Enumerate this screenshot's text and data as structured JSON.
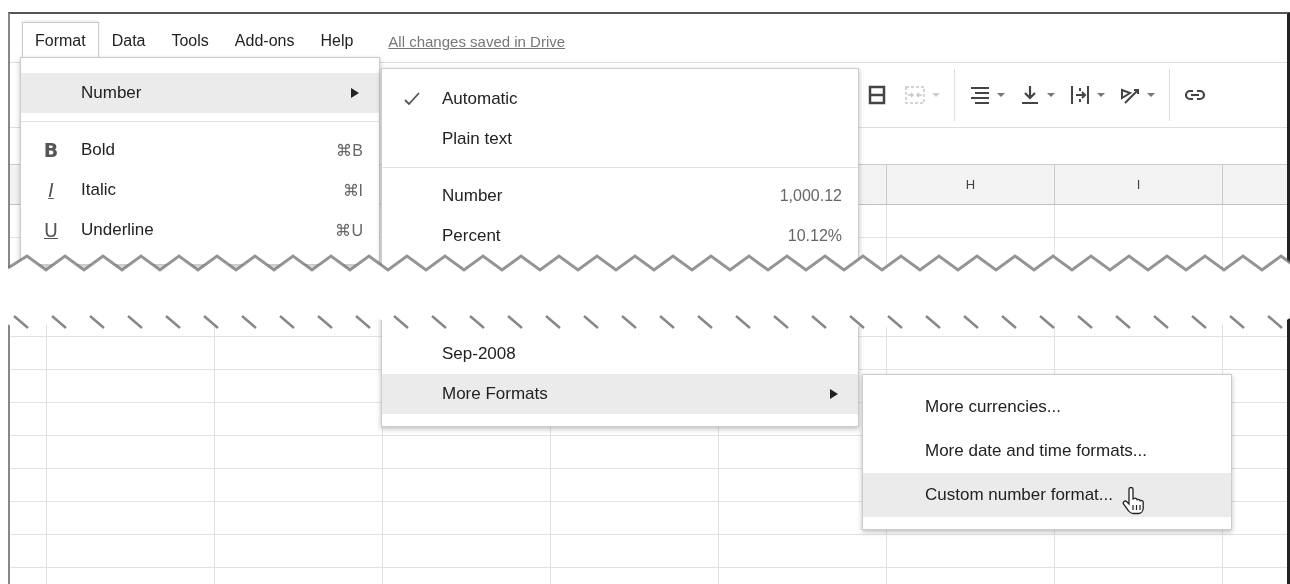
{
  "menubar": {
    "items": [
      {
        "label": "Format",
        "selected": true
      },
      {
        "label": "Data",
        "selected": false
      },
      {
        "label": "Tools",
        "selected": false
      },
      {
        "label": "Add-ons",
        "selected": false
      },
      {
        "label": "Help",
        "selected": false
      }
    ],
    "save_status": "All changes saved in Drive"
  },
  "toolbar": [
    {
      "kind": "borders",
      "disabled": false,
      "dropdown": false
    },
    {
      "kind": "merge",
      "disabled": true,
      "dropdown": true
    },
    {
      "kind": "halign",
      "disabled": false,
      "dropdown": true
    },
    {
      "kind": "valign",
      "disabled": false,
      "dropdown": true
    },
    {
      "kind": "wrap",
      "disabled": false,
      "dropdown": true
    },
    {
      "kind": "rotate",
      "disabled": false,
      "dropdown": true
    },
    {
      "kind": "link",
      "disabled": false,
      "dropdown": false
    }
  ],
  "column_headers": [
    "H",
    "I"
  ],
  "format_menu": {
    "items": [
      {
        "kind": "item",
        "label": "Number",
        "selected": true,
        "submenu": true
      },
      {
        "kind": "separator"
      },
      {
        "kind": "item",
        "glyph": "B",
        "label": "Bold",
        "shortcut": "⌘B",
        "selected": false,
        "submenu": false
      },
      {
        "kind": "item",
        "glyph": "I",
        "label": "Italic",
        "shortcut": "⌘I",
        "selected": false,
        "submenu": false
      },
      {
        "kind": "item",
        "glyph": "U",
        "label": "Underline",
        "shortcut": "⌘U",
        "selected": false,
        "submenu": false
      }
    ]
  },
  "number_menu": {
    "items": [
      {
        "kind": "item",
        "label": "Automatic",
        "checked": true,
        "selected": false,
        "submenu": false
      },
      {
        "kind": "item",
        "label": "Plain text",
        "checked": false,
        "selected": false,
        "submenu": false
      },
      {
        "kind": "separator"
      },
      {
        "kind": "item",
        "label": "Number",
        "shortcut": "1,000.12",
        "checked": false,
        "selected": false,
        "submenu": false
      },
      {
        "kind": "item",
        "label": "Percent",
        "shortcut": "10.12%",
        "checked": false,
        "selected": false,
        "submenu": false
      },
      {
        "kind": "break"
      },
      {
        "kind": "item",
        "label": "Sep-2008",
        "checked": false,
        "selected": false,
        "submenu": false
      },
      {
        "kind": "item",
        "label": "More Formats",
        "checked": false,
        "selected": true,
        "submenu": true
      }
    ]
  },
  "more_formats_menu": {
    "items": [
      {
        "kind": "item",
        "label": "More currencies...",
        "selected": false,
        "submenu": false
      },
      {
        "kind": "item",
        "label": "More date and time formats...",
        "selected": false,
        "submenu": false
      },
      {
        "kind": "item",
        "label": "Custom number format...",
        "selected": true,
        "submenu": false,
        "pointer": true
      }
    ]
  }
}
